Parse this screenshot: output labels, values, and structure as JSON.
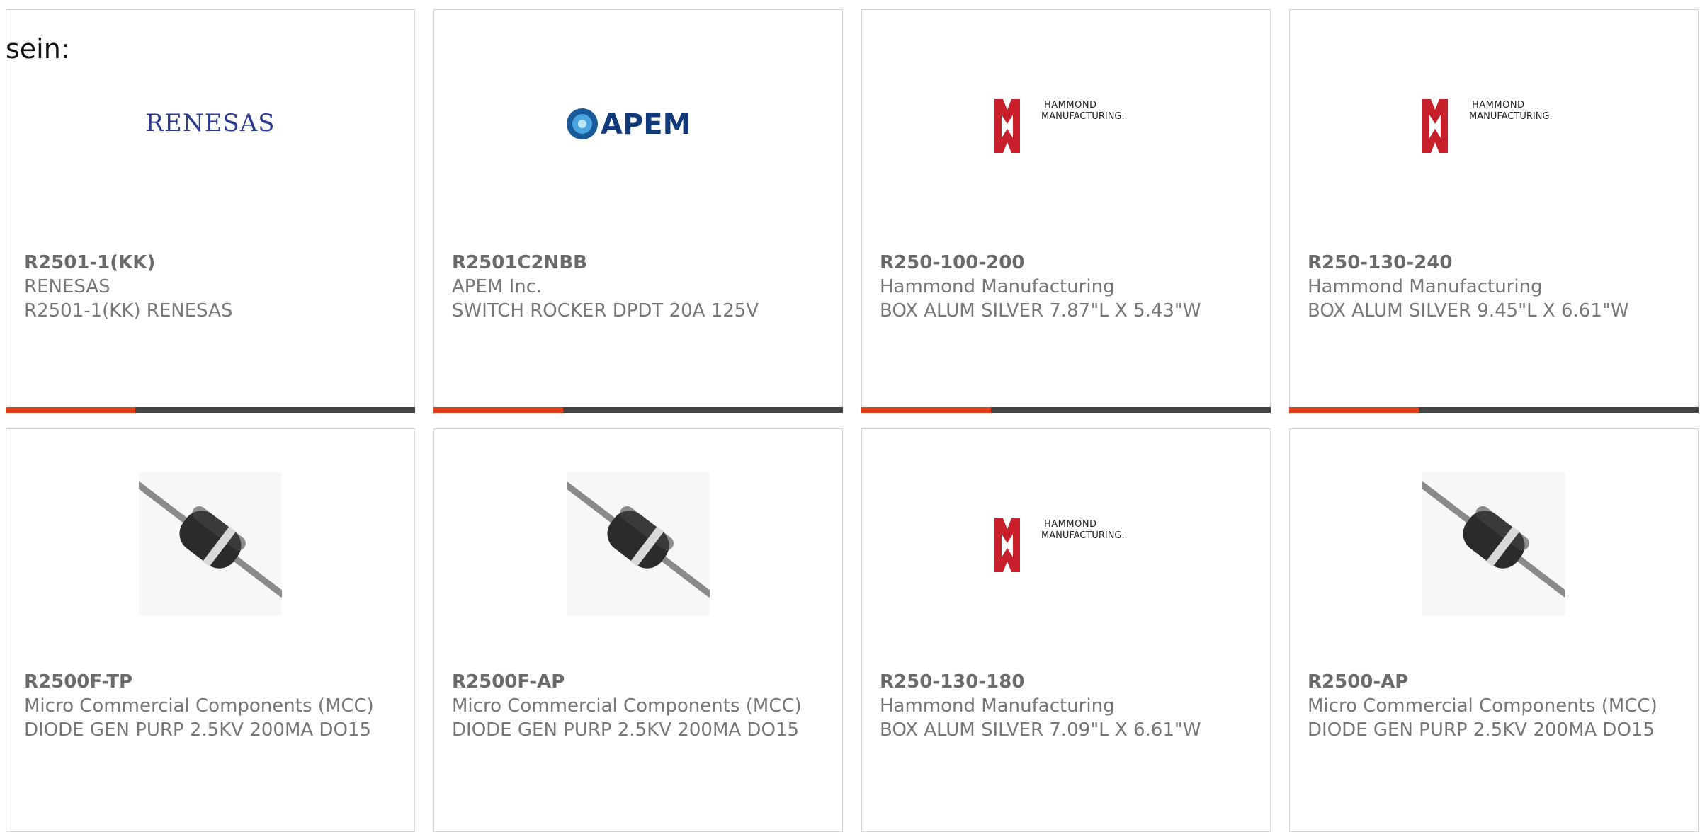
{
  "lead_text": "sein:",
  "products": [
    {
      "part_number": "R2501-1(KK)",
      "manufacturer": "RENESAS",
      "description": "R2501-1(KK) RENESAS",
      "image": "renesas-logo",
      "logo_text": "RENESAS"
    },
    {
      "part_number": "R2501C2NBB",
      "manufacturer": "APEM Inc.",
      "description": "SWITCH ROCKER DPDT 20A 125V",
      "image": "apem-logo",
      "logo_text": "APEM"
    },
    {
      "part_number": "R250-100-200",
      "manufacturer": "Hammond Manufacturing",
      "description": "BOX ALUM SILVER 7.87\"L X 5.43\"W",
      "image": "hammond-logo",
      "logo_line1": "HAMMOND",
      "logo_line2": "MANUFACTURING."
    },
    {
      "part_number": "R250-130-240",
      "manufacturer": "Hammond Manufacturing",
      "description": "BOX ALUM SILVER 9.45\"L X 6.61\"W",
      "image": "hammond-logo",
      "logo_line1": "HAMMOND",
      "logo_line2": "MANUFACTURING."
    },
    {
      "part_number": "R2500F-TP",
      "manufacturer": "Micro Commercial Components (MCC)",
      "description": "DIODE GEN PURP 2.5KV 200MA DO15",
      "image": "diode-photo"
    },
    {
      "part_number": "R2500F-AP",
      "manufacturer": "Micro Commercial Components (MCC)",
      "description": "DIODE GEN PURP 2.5KV 200MA DO15",
      "image": "diode-photo"
    },
    {
      "part_number": "R250-130-180",
      "manufacturer": "Hammond Manufacturing",
      "description": "BOX ALUM SILVER 7.09\"L X 6.61\"W",
      "image": "hammond-logo",
      "logo_line1": "HAMMOND",
      "logo_line2": "MANUFACTURING."
    },
    {
      "part_number": "R2500-AP",
      "manufacturer": "Micro Commercial Components (MCC)",
      "description": "DIODE GEN PURP 2.5KV 200MA DO15",
      "image": "diode-photo"
    }
  ],
  "colors": {
    "accent": "#e2401b",
    "bar": "#444444",
    "renesas_blue": "#2a3a8f",
    "apem_blue": "#1a5a9a",
    "hammond_red": "#c8202a"
  }
}
